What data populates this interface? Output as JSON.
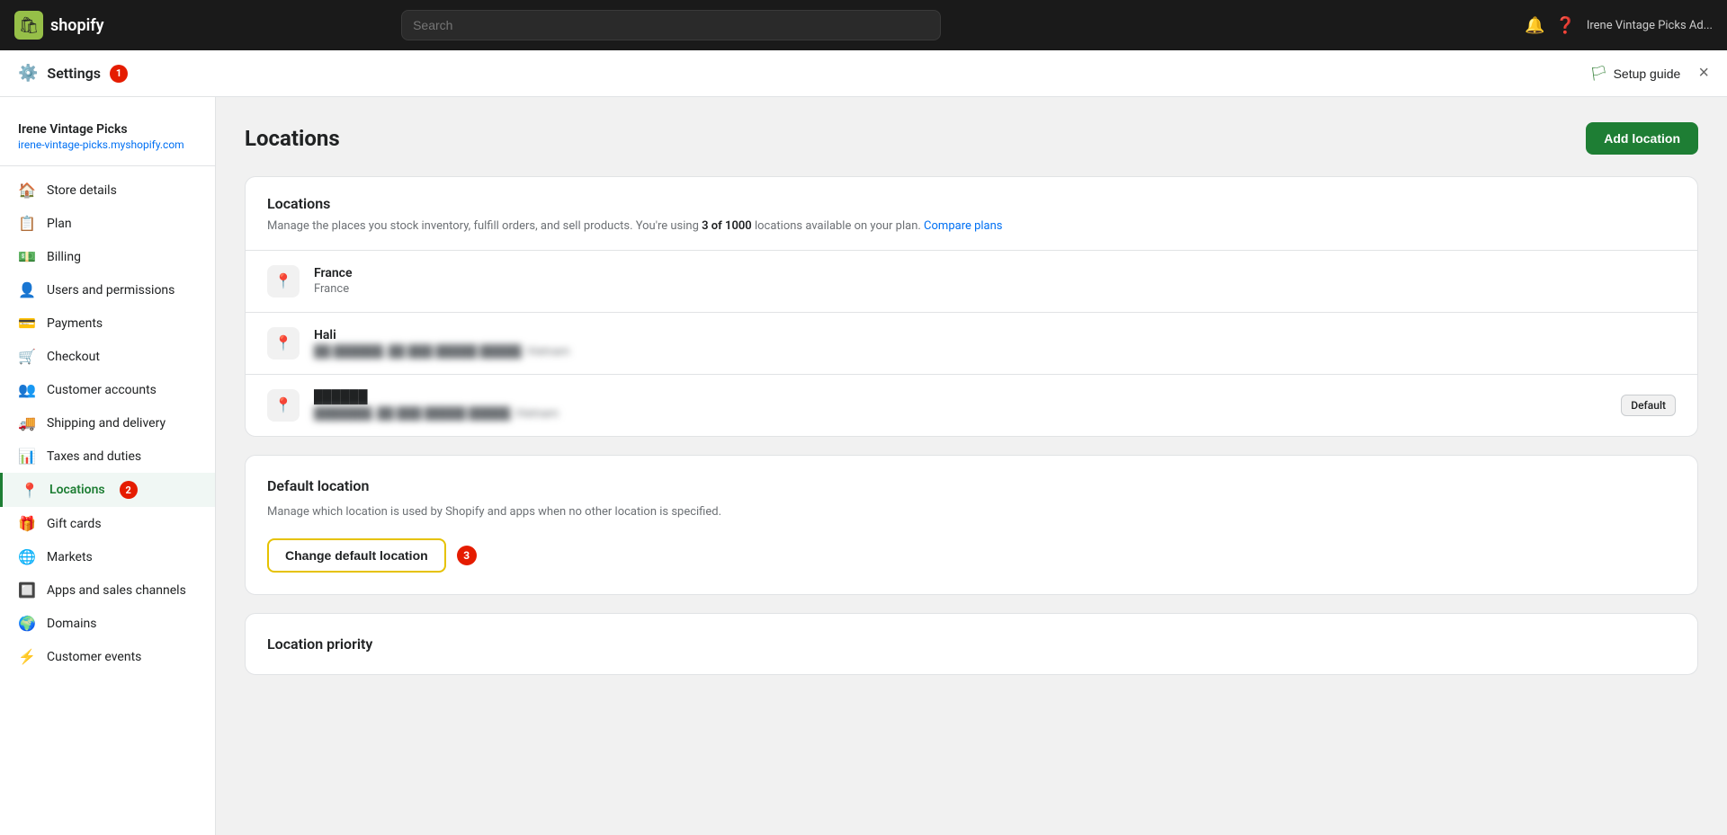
{
  "topbar": {
    "logo_text": "shopify",
    "search_placeholder": "Search",
    "user_name": "Irene Vintage Picks Ad..."
  },
  "settings_bar": {
    "title": "Settings",
    "badge": "1",
    "setup_guide": "Setup guide",
    "close_label": "×"
  },
  "sidebar": {
    "store_name": "Irene Vintage Picks",
    "store_url": "irene-vintage-picks.myshopify.com",
    "nav_items": [
      {
        "id": "store-details",
        "label": "Store details",
        "icon": "🏠"
      },
      {
        "id": "plan",
        "label": "Plan",
        "icon": "📋"
      },
      {
        "id": "billing",
        "label": "Billing",
        "icon": "💵"
      },
      {
        "id": "users-permissions",
        "label": "Users and permissions",
        "icon": "👤"
      },
      {
        "id": "payments",
        "label": "Payments",
        "icon": "💳"
      },
      {
        "id": "checkout",
        "label": "Checkout",
        "icon": "🛒"
      },
      {
        "id": "customer-accounts",
        "label": "Customer accounts",
        "icon": "👥"
      },
      {
        "id": "shipping-delivery",
        "label": "Shipping and delivery",
        "icon": "🚚"
      },
      {
        "id": "taxes-duties",
        "label": "Taxes and duties",
        "icon": "📊"
      },
      {
        "id": "locations",
        "label": "Locations",
        "icon": "📍",
        "active": true,
        "badge": "2"
      },
      {
        "id": "gift-cards",
        "label": "Gift cards",
        "icon": "🎁"
      },
      {
        "id": "markets",
        "label": "Markets",
        "icon": "🌐"
      },
      {
        "id": "apps-sales-channels",
        "label": "Apps and sales channels",
        "icon": "🔲"
      },
      {
        "id": "domains",
        "label": "Domains",
        "icon": "🌍"
      },
      {
        "id": "customer-events",
        "label": "Customer events",
        "icon": "⚡"
      }
    ]
  },
  "page": {
    "title": "Locations",
    "add_button": "Add location"
  },
  "locations_card": {
    "title": "Locations",
    "subtitle_before": "Manage the places you stock inventory, fulfill orders, and sell products. You're using ",
    "usage_count": "3",
    "usage_limit": "1000",
    "subtitle_after": " locations available on your plan.",
    "compare_plans": "Compare plans",
    "locations": [
      {
        "name": "France",
        "address": "France",
        "blurred": false,
        "is_default": false
      },
      {
        "name": "Hali",
        "address": "██ ██████, ██ ███ █████ █████, Vietnam",
        "blurred": true,
        "is_default": false
      },
      {
        "name": "██████",
        "address": "███████, ██ ███ █████ █████, Vietnam",
        "blurred": true,
        "is_default": true,
        "default_label": "Default"
      }
    ]
  },
  "default_location": {
    "title": "Default location",
    "description": "Manage which location is used by Shopify and apps when no other location is specified.",
    "change_button": "Change default location",
    "step_badge": "3"
  },
  "location_priority": {
    "title": "Location priority"
  }
}
